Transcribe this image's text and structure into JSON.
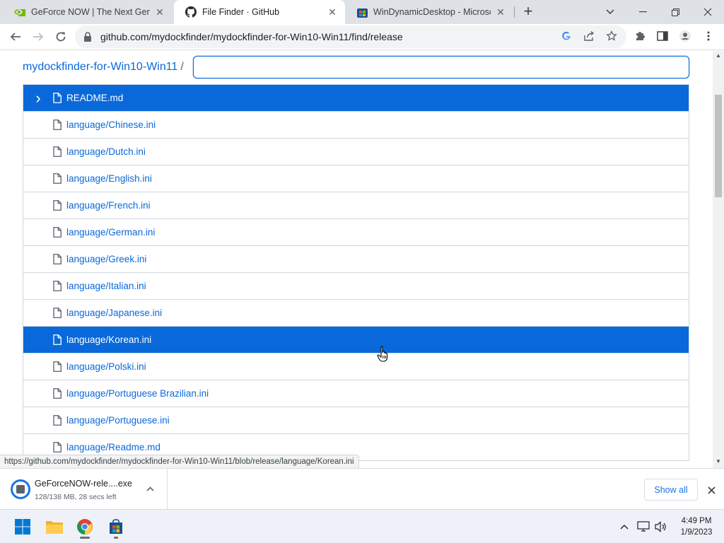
{
  "browser": {
    "tabs": [
      {
        "title": "GeForce NOW | The Next Genera",
        "icon": "nvidia-icon",
        "active": false
      },
      {
        "title": "File Finder · GitHub",
        "icon": "github-icon",
        "active": true
      },
      {
        "title": "WinDynamicDesktop - Microsoft",
        "icon": "ms-store-icon",
        "active": false
      }
    ],
    "url": "github.com/mydockfinder/mydockfinder-for-Win10-Win11/find/release"
  },
  "finder": {
    "repo_name": "mydockfinder-for-Win10-Win11",
    "separator": "/",
    "query": "",
    "files": [
      {
        "path": "README.md",
        "selected": true,
        "chevron": true
      },
      {
        "path": "language/Chinese.ini"
      },
      {
        "path": "language/Dutch.ini"
      },
      {
        "path": "language/English.ini"
      },
      {
        "path": "language/French.ini"
      },
      {
        "path": "language/German.ini"
      },
      {
        "path": "language/Greek.ini"
      },
      {
        "path": "language/Italian.ini"
      },
      {
        "path": "language/Japanese.ini"
      },
      {
        "path": "language/Korean.ini",
        "selected": true
      },
      {
        "path": "language/Polski.ini"
      },
      {
        "path": "language/Portuguese Brazilian.ini"
      },
      {
        "path": "language/Portuguese.ini"
      },
      {
        "path": "language/Readme.md"
      }
    ]
  },
  "status_url": "https://github.com/mydockfinder/mydockfinder-for-Win10-Win11/blob/release/language/Korean.ini",
  "download": {
    "filename": "GeForceNOW-rele....exe",
    "status": "128/138 MB, 28 secs left",
    "progress_percent": 93,
    "show_all": "Show all"
  },
  "taskbar": {
    "apps": [
      "windows-start-icon",
      "file-explorer-icon",
      "chrome-icon",
      "ms-store-icon"
    ],
    "time": "4:49 PM",
    "date": "1/9/2023"
  },
  "colors": {
    "accent": "#0969da",
    "link": "#0969da",
    "chrome_blue": "#1a73e8"
  }
}
